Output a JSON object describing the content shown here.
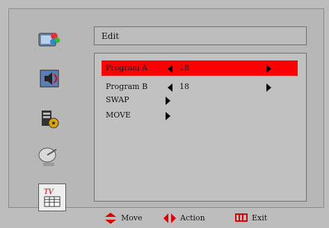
{
  "title": "Edit",
  "rows": [
    {
      "label": "Program A",
      "value": "18"
    },
    {
      "label": "Program B",
      "value": "18"
    },
    {
      "label": "SWAP",
      "value": ""
    },
    {
      "label": "MOVE",
      "value": ""
    }
  ],
  "footer": {
    "move_label": "Move",
    "action_label": "Action",
    "exit_label": "Exit"
  },
  "colors": {
    "highlight": "#ff0000",
    "background": "#bdbdbd"
  },
  "icons": [
    "picture-settings-icon",
    "sound-settings-icon",
    "channel-settings-icon",
    "satellite-dish-icon",
    "tv-guide-icon"
  ]
}
